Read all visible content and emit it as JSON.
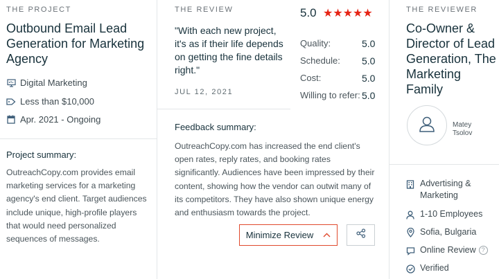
{
  "project": {
    "section_label": "THE PROJECT",
    "title": "Outbound Email Lead Generation for Marketing Agency",
    "service": "Digital Marketing",
    "budget": "Less than $10,000",
    "dates": "Apr. 2021 - Ongoing",
    "summary_heading": "Project summary:",
    "summary_text": "OutreachCopy.com provides email marketing services for a marketing agency's end client. Target audiences include unique, high-profile players that would need personalized sequences of messages."
  },
  "review": {
    "section_label": "THE REVIEW",
    "quote": "\"With each new project, it's as if their life depends on getting the fine details right.\"",
    "date": "JUL 12, 2021",
    "overall_score": "5.0",
    "stars": "★★★★★",
    "star_count": 5,
    "ratings": [
      {
        "label": "Quality:",
        "value": "5.0"
      },
      {
        "label": "Schedule:",
        "value": "5.0"
      },
      {
        "label": "Cost:",
        "value": "5.0"
      },
      {
        "label": "Willing to refer:",
        "value": "5.0"
      }
    ],
    "feedback_heading": "Feedback summary:",
    "feedback_text": "OutreachCopy.com has increased the end client's open rates, reply rates, and booking rates significantly. Audiences have been impressed by their content, showing how the vendor can outwit many of its competitors. They have also shown unique energy and enthusiasm towards the project.",
    "minimize_label": "Minimize Review"
  },
  "reviewer": {
    "section_label": "THE REVIEWER",
    "title": "Co-Owner & Director of Lead Generation, The Marketing Family",
    "name_line1": "Matey",
    "name_line2": "Tsolov",
    "industry": "Advertising & Marketing",
    "employees": "1-10 Employees",
    "location": "Sofia, Bulgaria",
    "review_type": "Online Review",
    "verification": "Verified"
  },
  "colors": {
    "accent_red": "#e62415",
    "button_border": "#e0492c",
    "text_dark": "#17313b",
    "divider": "#e3e6e8"
  },
  "icons": {
    "service": "monitor-icon",
    "budget": "price-tag-icon",
    "dates": "calendar-icon",
    "industry": "building-icon",
    "employees": "user-icon",
    "location": "location-pin-icon",
    "review_type": "chat-icon",
    "verification": "check-circle-icon",
    "share": "share-icon",
    "chevron": "chevron-up-icon"
  }
}
